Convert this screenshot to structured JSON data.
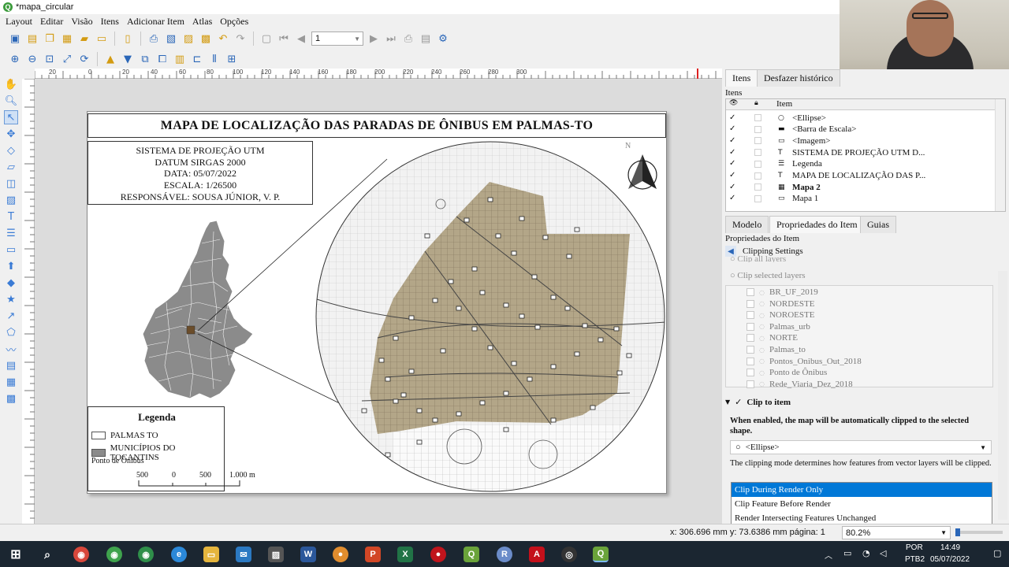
{
  "window": {
    "title": "*mapa_circular"
  },
  "menu": [
    "Layout",
    "Editar",
    "Visão",
    "Itens",
    "Adicionar Item",
    "Atlas",
    "Opções"
  ],
  "toolbar": {
    "page_value": "1"
  },
  "ruler": {
    "labels": [
      "20",
      "0",
      "20",
      "40",
      "60",
      "80",
      "100",
      "120",
      "140",
      "160",
      "180",
      "200",
      "220",
      "240",
      "260",
      "280",
      "300"
    ]
  },
  "map": {
    "title": "MAPA DE LOCALIZAÇÃO DAS PARADAS DE ÔNIBUS EM PALMAS-TO",
    "info": [
      "SISTEMA DE PROJEÇÃO UTM",
      "DATUM SIRGAS 2000",
      "DATA: 05/07/2022",
      "ESCALA: 1/26500",
      "RESPONSÁVEL: SOUSA JÚNIOR, V. P."
    ],
    "north_label": "N",
    "legend": {
      "title": "Legenda",
      "items": [
        "PALMAS TO",
        "MUNICÍPIOS DO TOCANTINS",
        "Ponto de Ônibus"
      ]
    },
    "scale_labels": [
      "500",
      "0",
      "500",
      "1.000 m"
    ]
  },
  "panel": {
    "tabs_top": [
      "Itens",
      "Desfazer histórico"
    ],
    "items_header": "Itens",
    "items_col": "Item",
    "items": [
      {
        "label": "<Ellipse>",
        "bold": false
      },
      {
        "label": "<Barra de Escala>",
        "bold": false
      },
      {
        "label": "<Imagem>",
        "bold": false
      },
      {
        "label": "SISTEMA DE PROJEÇÃO UTM D...",
        "bold": false
      },
      {
        "label": "Legenda",
        "bold": false
      },
      {
        "label": "MAPA DE LOCALIZAÇÃO DAS P...",
        "bold": false
      },
      {
        "label": "Mapa 2",
        "bold": true
      },
      {
        "label": "Mapa 1",
        "bold": false
      }
    ],
    "tabs_bottom": [
      "Modelo",
      "Propriedades do Item",
      "Guias"
    ],
    "props_header": "Propriedades do Item",
    "clipping_title": "Clipping Settings",
    "clip_all_layers": "Clip all layers",
    "clip_selected_layers": "Clip selected layers",
    "layers": [
      "BR_UF_2019",
      "NORDESTE",
      "NOROESTE",
      "Palmas_urb",
      "NORTE",
      "Palmas_to",
      "Pontos_Onibus_Out_2018",
      "Ponto de Ônibus",
      "Rede_Viaria_Dez_2018"
    ],
    "clip_to_item": "Clip to item",
    "clip_desc": "When enabled, the map will be automatically clipped to the selected shape.",
    "clip_shape": "<Ellipse>",
    "clip_mode_desc": "The clipping mode determines how features from vector layers will be clipped.",
    "clip_modes": [
      "Clip During Render Only",
      "Clip Feature Before Render",
      "Render Intersecting Features Unchanged"
    ],
    "selected_mode": "Clip During Render Only"
  },
  "status": {
    "coords": "x: 306.696 mm y: 73.6386 mm página: 1",
    "zoom": "80.2%"
  },
  "taskbar": {
    "lang": "POR",
    "layout": "PTB2",
    "time": "14:49",
    "date": "05/07/2022"
  },
  "colors": {
    "urban": "#b3a688",
    "accent": "#0078d7",
    "taskbar": "#1b2631"
  }
}
